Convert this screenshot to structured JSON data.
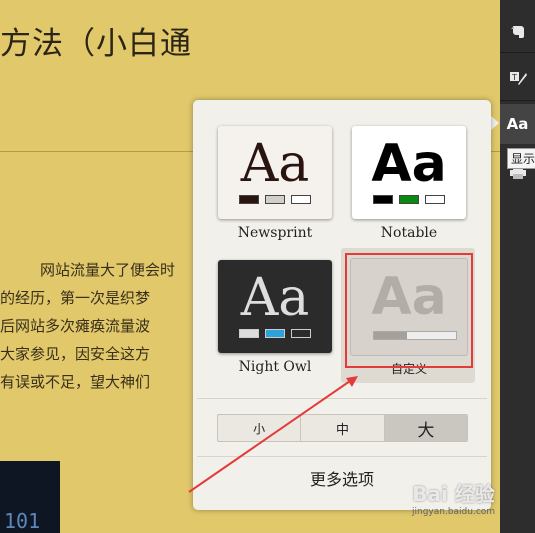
{
  "article": {
    "title": "方法（小白通",
    "lines": [
      "网站流量大了便会时",
      "的经历，第一次是织梦",
      "后网站多次瘫痪流量波",
      "大家参见，因安全这方",
      "有误或不足，望大神们"
    ],
    "thumb_code": "101"
  },
  "toolbar": {
    "format_label": "Aa",
    "tooltip": "显示"
  },
  "themes": [
    {
      "label": "Newsprint",
      "glyph": "Aa",
      "swatches": [
        "#2a1410",
        "#d2cfcb",
        "#ffffff"
      ]
    },
    {
      "label": "Notable",
      "glyph": "Aa",
      "swatches": [
        "#000000",
        "#0a8a12",
        "#ffffff"
      ]
    },
    {
      "label": "Night Owl",
      "glyph": "Aa",
      "swatches": [
        "#dddddd",
        "#2aa3db",
        "#2b2b2b"
      ]
    },
    {
      "label": "自定义",
      "glyph": "Aa",
      "progress": 0.4
    }
  ],
  "sizes": {
    "small": "小",
    "medium": "中",
    "large": "大",
    "selected": "large"
  },
  "more_options": "更多选项",
  "highlight_color": "#e53a3a",
  "watermark": {
    "logo": "Bai 经验",
    "url": "jingyan.baidu.com"
  }
}
